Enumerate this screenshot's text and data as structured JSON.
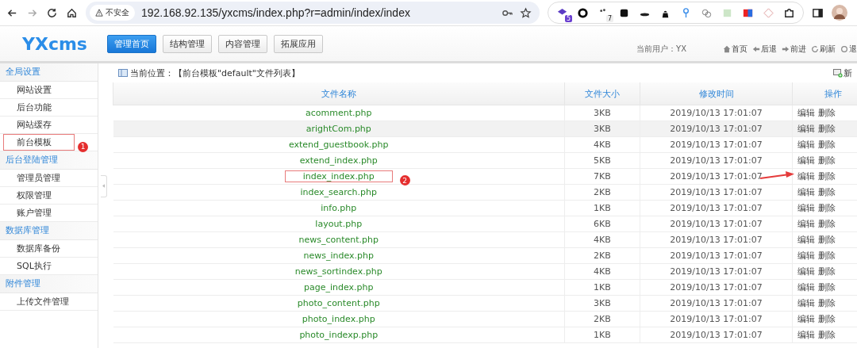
{
  "browser": {
    "security_label": "不安全",
    "url": "192.168.92.135/yxcms/index.php?r=admin/index/index",
    "extensions": [
      {
        "kind": "stack",
        "badge": "5"
      },
      {
        "kind": "ring"
      },
      {
        "kind": "dots",
        "badge": "7"
      },
      {
        "kind": "square"
      },
      {
        "kind": "hat"
      },
      {
        "kind": "spy"
      },
      {
        "kind": "pin"
      },
      {
        "kind": "circles"
      },
      {
        "kind": "js"
      },
      {
        "kind": "flag"
      },
      {
        "kind": "diamond"
      },
      {
        "kind": "puzzle"
      }
    ]
  },
  "header": {
    "logo": "YXcms",
    "nav": [
      {
        "label": "管理首页",
        "selected": true
      },
      {
        "label": "结构管理",
        "selected": false
      },
      {
        "label": "内容管理",
        "selected": false
      },
      {
        "label": "拓展应用",
        "selected": false
      }
    ],
    "current_user": "当前用户：YX",
    "links": [
      {
        "kind": "home",
        "label": "首页"
      },
      {
        "kind": "back",
        "label": "后退"
      },
      {
        "kind": "forward",
        "label": "前进"
      },
      {
        "kind": "refresh",
        "label": "刷新"
      },
      {
        "kind": "logout",
        "label": "退"
      }
    ]
  },
  "sidebar": {
    "groups": [
      {
        "title": "全局设置",
        "items": [
          {
            "label": "网站设置"
          },
          {
            "label": "后台功能"
          },
          {
            "label": "网站缓存"
          },
          {
            "label": "前台模板",
            "annotation": "1"
          }
        ]
      },
      {
        "title": "后台登陆管理",
        "items": [
          {
            "label": "管理员管理"
          },
          {
            "label": "权限管理"
          },
          {
            "label": "账户管理"
          }
        ]
      },
      {
        "title": "数据库管理",
        "items": [
          {
            "label": "数据库备份"
          },
          {
            "label": "SQL执行"
          }
        ]
      },
      {
        "title": "附件管理",
        "items": [
          {
            "label": "上传文件管理"
          }
        ]
      }
    ]
  },
  "breadcrumb": "当前位置：【前台模板\"default\"文件列表】",
  "new_button": "新",
  "table": {
    "columns": [
      "文件名称",
      "文件大小",
      "修改时间",
      "操作"
    ],
    "rows": [
      {
        "name": "acomment.php",
        "size": "3KB",
        "modified": "2019/10/13 17:01:07",
        "actions": [
          "编辑",
          "删除"
        ],
        "highlighted": false
      },
      {
        "name": "arightCom.php",
        "size": "3KB",
        "modified": "2019/10/13 17:01:07",
        "actions": [
          "编辑",
          "删除"
        ],
        "highlighted": true
      },
      {
        "name": "extend_guestbook.php",
        "size": "4KB",
        "modified": "2019/10/13 17:01:07",
        "actions": [
          "编辑",
          "删除"
        ],
        "highlighted": false
      },
      {
        "name": "extend_index.php",
        "size": "5KB",
        "modified": "2019/10/13 17:01:07",
        "actions": [
          "编辑",
          "删除"
        ],
        "highlighted": false
      },
      {
        "name": "index_index.php",
        "size": "7KB",
        "modified": "2019/10/13 17:01:07",
        "actions": [
          "编辑",
          "删除"
        ],
        "highlighted": false,
        "annotation": "2",
        "arrow": true
      },
      {
        "name": "index_search.php",
        "size": "2KB",
        "modified": "2019/10/13 17:01:07",
        "actions": [
          "编辑",
          "删除"
        ],
        "highlighted": false
      },
      {
        "name": "info.php",
        "size": "1KB",
        "modified": "2019/10/13 17:01:07",
        "actions": [
          "编辑",
          "删除"
        ],
        "highlighted": false
      },
      {
        "name": "layout.php",
        "size": "6KB",
        "modified": "2019/10/13 17:01:07",
        "actions": [
          "编辑",
          "删除"
        ],
        "highlighted": false
      },
      {
        "name": "news_content.php",
        "size": "4KB",
        "modified": "2019/10/13 17:01:07",
        "actions": [
          "编辑",
          "删除"
        ],
        "highlighted": false
      },
      {
        "name": "news_index.php",
        "size": "2KB",
        "modified": "2019/10/13 17:01:07",
        "actions": [
          "编辑",
          "删除"
        ],
        "highlighted": false
      },
      {
        "name": "news_sortindex.php",
        "size": "4KB",
        "modified": "2019/10/13 17:01:07",
        "actions": [
          "编辑",
          "删除"
        ],
        "highlighted": false
      },
      {
        "name": "page_index.php",
        "size": "1KB",
        "modified": "2019/10/13 17:01:07",
        "actions": [
          "编辑",
          "删除"
        ],
        "highlighted": false
      },
      {
        "name": "photo_content.php",
        "size": "3KB",
        "modified": "2019/10/13 17:01:07",
        "actions": [
          "编辑",
          "删除"
        ],
        "highlighted": false
      },
      {
        "name": "photo_index.php",
        "size": "2KB",
        "modified": "2019/10/13 17:01:07",
        "actions": [
          "编辑",
          "删除"
        ],
        "highlighted": false
      },
      {
        "name": "photo_indexp.php",
        "size": "1KB",
        "modified": "2019/10/13 17:01:07",
        "actions": [
          "编辑",
          "删除"
        ],
        "highlighted": false
      }
    ]
  }
}
